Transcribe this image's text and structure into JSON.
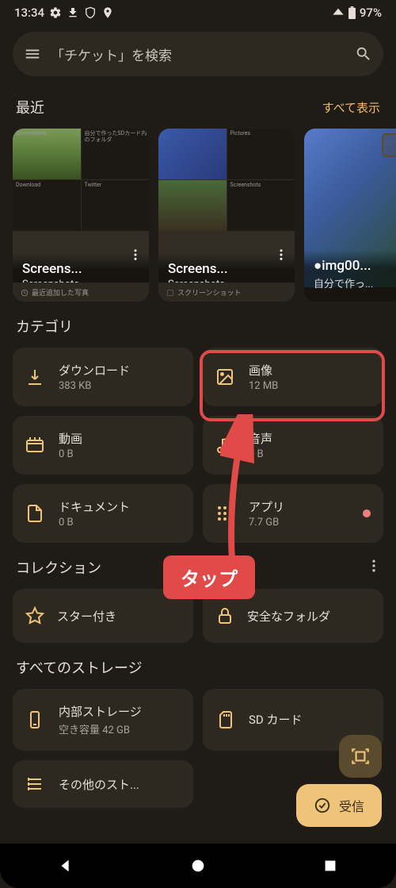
{
  "statusbar": {
    "time": "13:34",
    "battery": "97%"
  },
  "search": {
    "placeholder": "「チケット」を検索"
  },
  "recent": {
    "title": "最近",
    "see_all": "すべて表示",
    "cards": [
      {
        "title": "Screens...",
        "subtitle": "Screenshots",
        "footer": "最近追加した写真",
        "thumbs": [
          "Screenshots",
          "自分で作ったSDカード内のフォルダ",
          "Download",
          "Twitter"
        ]
      },
      {
        "title": "Screens...",
        "subtitle": "Screenshots",
        "footer": "スクリーンショット",
        "thumbs": [
          "",
          "Pictures",
          "",
          "Screenshots"
        ]
      },
      {
        "title": "●img00...",
        "subtitle": "自分で作っ..."
      }
    ]
  },
  "categories": {
    "title": "カテゴリ",
    "items": [
      {
        "label": "ダウンロード",
        "size": "383 KB"
      },
      {
        "label": "画像",
        "size": "12 MB"
      },
      {
        "label": "動画",
        "size": "0 B"
      },
      {
        "label": "音声",
        "size": "0 B"
      },
      {
        "label": "ドキュメント",
        "size": "0 B"
      },
      {
        "label": "アプリ",
        "size": "7.7 GB"
      }
    ]
  },
  "collections": {
    "title": "コレクション",
    "items": [
      {
        "label": "スター付き"
      },
      {
        "label": "安全なフォルダ"
      }
    ]
  },
  "storage": {
    "title": "すべてのストレージ",
    "items": [
      {
        "label": "内部ストレージ",
        "size": "空き容量 42 GB"
      },
      {
        "label": "SD カード",
        "size": ""
      },
      {
        "label": "その他のスト..."
      }
    ]
  },
  "fab": {
    "receive": "受信"
  },
  "annotation": {
    "callout": "タップ"
  }
}
